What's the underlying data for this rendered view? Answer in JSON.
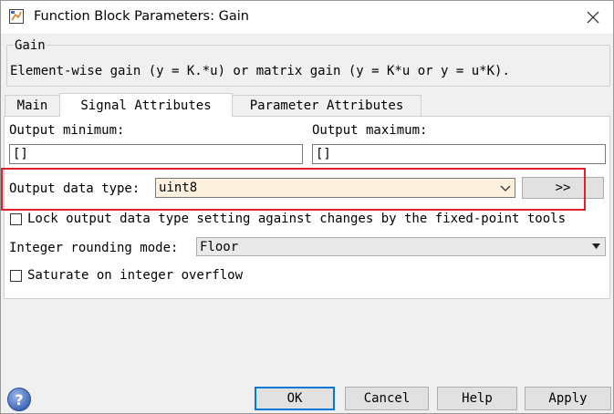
{
  "window": {
    "title": "Function Block Parameters: Gain"
  },
  "group": {
    "title": "Gain",
    "description": "Element-wise gain (y = K.*u) or matrix gain (y = K*u or y = u*K)."
  },
  "tabs": [
    {
      "label": "Main",
      "active": false
    },
    {
      "label": "Signal Attributes",
      "active": true
    },
    {
      "label": "Parameter Attributes",
      "active": false
    }
  ],
  "signal_attributes": {
    "output_minimum_label": "Output minimum:",
    "output_minimum_value": "[]",
    "output_maximum_label": "Output maximum:",
    "output_maximum_value": "[]",
    "output_data_type_label": "Output data type:",
    "output_data_type_value": "uint8",
    "data_type_assistant_label": ">>",
    "lock_label": "Lock output data type setting against changes by the fixed-point tools",
    "lock_checked": false,
    "rounding_label": "Integer rounding mode:",
    "rounding_value": "Floor",
    "saturate_label": "Saturate on integer overflow",
    "saturate_checked": false
  },
  "buttons": {
    "ok": "OK",
    "cancel": "Cancel",
    "help": "Help",
    "apply": "Apply"
  },
  "icons": {
    "app": "simulink-block-icon",
    "close": "close-icon",
    "help": "help-question-icon",
    "dropdown": "chevron-down-icon"
  },
  "colors": {
    "highlight_border": "#e0202c",
    "data_type_field_bg": "#fdf0dc",
    "default_button_border": "#0078d7",
    "help_icon_blue": "#3a63b8"
  }
}
